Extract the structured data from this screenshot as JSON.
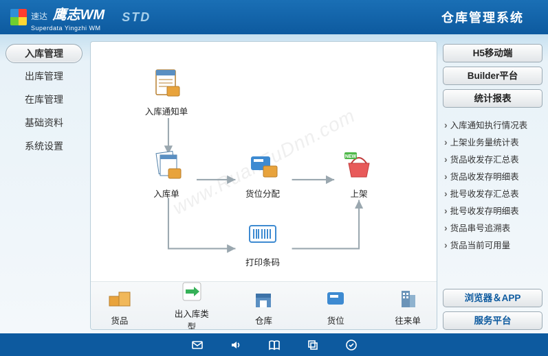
{
  "header": {
    "logo_brand_cn": "速达",
    "logo_wm": "鹰志WM",
    "logo_sub": "Superdata Yingzhi WM",
    "edition": "STD",
    "title": "仓库管理系统"
  },
  "left_nav": [
    {
      "id": "inbound",
      "label": "入库管理",
      "active": true
    },
    {
      "id": "outbound",
      "label": "出库管理",
      "active": false
    },
    {
      "id": "instock",
      "label": "在库管理",
      "active": false
    },
    {
      "id": "basedata",
      "label": "基础资料",
      "active": false
    },
    {
      "id": "settings",
      "label": "系统设置",
      "active": false
    }
  ],
  "diagram": {
    "nodes": {
      "notice": "入库通知单",
      "inbound": "入库单",
      "alloc": "货位分配",
      "shelve": "上架",
      "barcode": "打印条码"
    }
  },
  "bottom_items": [
    {
      "id": "goods",
      "label": "货品"
    },
    {
      "id": "iotype",
      "label": "出入库类型"
    },
    {
      "id": "warehouse",
      "label": "仓库"
    },
    {
      "id": "location",
      "label": "货位"
    },
    {
      "id": "vendor",
      "label": "往来单"
    }
  ],
  "right": {
    "buttons_top": [
      {
        "id": "h5",
        "label": "H5移动端"
      },
      {
        "id": "builder",
        "label": "Builder平台"
      },
      {
        "id": "reports",
        "label": "统计报表"
      }
    ],
    "reports": [
      "入库通知执行情况表",
      "上架业务量统计表",
      "货品收发存汇总表",
      "货品收发存明细表",
      "批号收发存汇总表",
      "批号收发存明细表",
      "货品串号追溯表",
      "货品当前可用量"
    ],
    "buttons_bottom": [
      {
        "id": "browser",
        "label": "浏览器＆APP"
      },
      {
        "id": "service",
        "label": "服务平台"
      }
    ]
  },
  "footer_icons": [
    "mail-icon",
    "sound-icon",
    "book-icon",
    "copy-icon",
    "check-icon"
  ],
  "watermark": "www.RuanFuDnn.com"
}
